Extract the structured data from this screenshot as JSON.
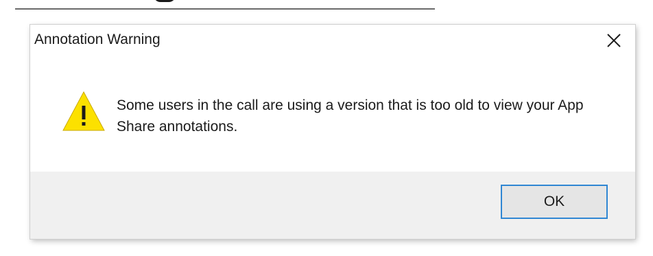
{
  "dialog": {
    "title": "Annotation Warning",
    "message": "Some users in the call are using a version that is too old to view your App Share annotations.",
    "icon": "warning-icon",
    "close_icon": "close-icon",
    "buttons": {
      "ok_label": "OK"
    }
  },
  "colors": {
    "warning_yellow": "#fce100",
    "button_focus_border": "#2f86d3",
    "footer_background": "#f0f0f0"
  }
}
